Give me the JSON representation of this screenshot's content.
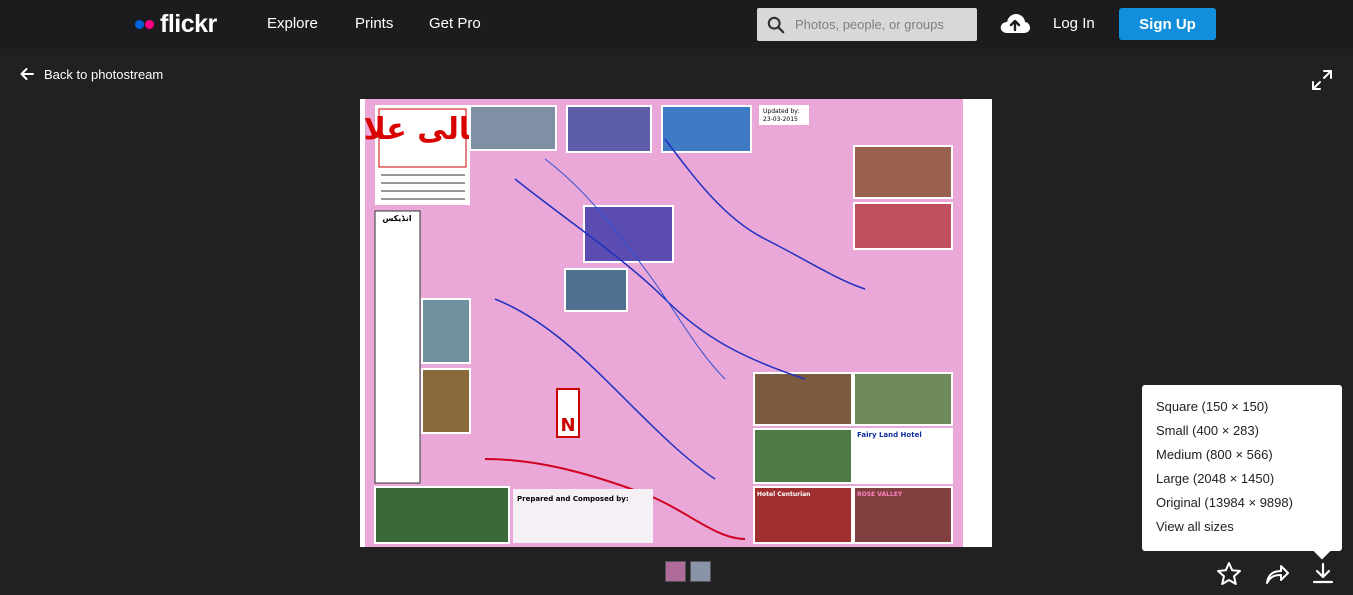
{
  "brand": {
    "name": "flickr",
    "dot1": "#0063dc",
    "dot2": "#ff0084"
  },
  "nav": {
    "explore": "Explore",
    "prints": "Prints",
    "get_pro": "Get Pro"
  },
  "search": {
    "placeholder": "Photos, people, or groups",
    "icon": "search-icon"
  },
  "header": {
    "upload_icon": "cloud-upload-icon",
    "login": "Log In",
    "signup": "Sign Up",
    "accent": "#128fdc"
  },
  "back": {
    "label": "Back to photostream"
  },
  "photo": {
    "updated": "Updated by:",
    "updated_date": "23-03-2015",
    "title_urdu": "شمالی علاقے",
    "index_label": "انڈیکس",
    "north": "N",
    "fairy": "Fairy Land Hotel",
    "centurian": "Hotel Centurian",
    "rose": "ROSE VALLEY",
    "prepared": "Prepared and Composed by:"
  },
  "sizes": [
    "Square (150 × 150)",
    "Small (400 × 283)",
    "Medium (800 × 566)",
    "Large (2048 × 1450)",
    "Original (13984 × 9898)",
    "View all sizes"
  ],
  "actions": {
    "favorite_icon": "star-icon",
    "share_icon": "share-icon",
    "download_icon": "download-icon",
    "expand_icon": "expand-icon"
  }
}
